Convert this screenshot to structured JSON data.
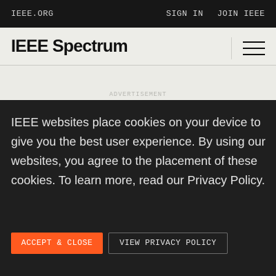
{
  "topbar": {
    "site_link": "IEEE.ORG",
    "sign_in": "SIGN IN",
    "join": "JOIN IEEE"
  },
  "header": {
    "logo": "IEEE Spectrum",
    "menu_icon": "hamburger-menu-icon"
  },
  "ad": {
    "label": "ADVERTISEMENT"
  },
  "cookie_banner": {
    "message": "IEEE websites place cookies on your device to give you the best user experience. By using our websites, you agree to the placement of these cookies. To learn more, read our Privacy Policy.",
    "accept_label": "ACCEPT & CLOSE",
    "privacy_label": "VIEW PRIVACY POLICY"
  },
  "colors": {
    "topbar_bg": "#171717",
    "header_bg": "#edede8",
    "banner_bg": "#1f1f1f",
    "accent": "#ff5a1f"
  }
}
